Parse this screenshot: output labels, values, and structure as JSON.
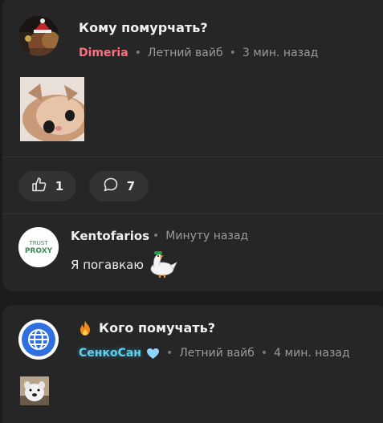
{
  "post1": {
    "title": "Кому помурчать?",
    "author": "Dimeria",
    "category": "Летний вайб",
    "time": "3 мин. назад",
    "likes": "1",
    "comments": "7"
  },
  "comment1": {
    "avatar_text_line1": "TRUST",
    "avatar_text_line2": "PROXY",
    "author": "Kentofarios",
    "time": "Минуту назад",
    "text": "Я погавкаю"
  },
  "post2": {
    "title": "Кого помучать?",
    "author": "СенкоСан",
    "category": "Летний вайб",
    "time": "4 мин. назад"
  },
  "colors": {
    "accent_red": "#ff6f7d",
    "accent_blue": "#5cd2f0",
    "card_bg": "#262626",
    "page_bg": "#1c1c1c"
  },
  "icons": [
    "thumbs-up-icon",
    "comment-bubble-icon",
    "fire-icon",
    "heart-icon",
    "goose-sticker-icon",
    "globe-icon"
  ]
}
